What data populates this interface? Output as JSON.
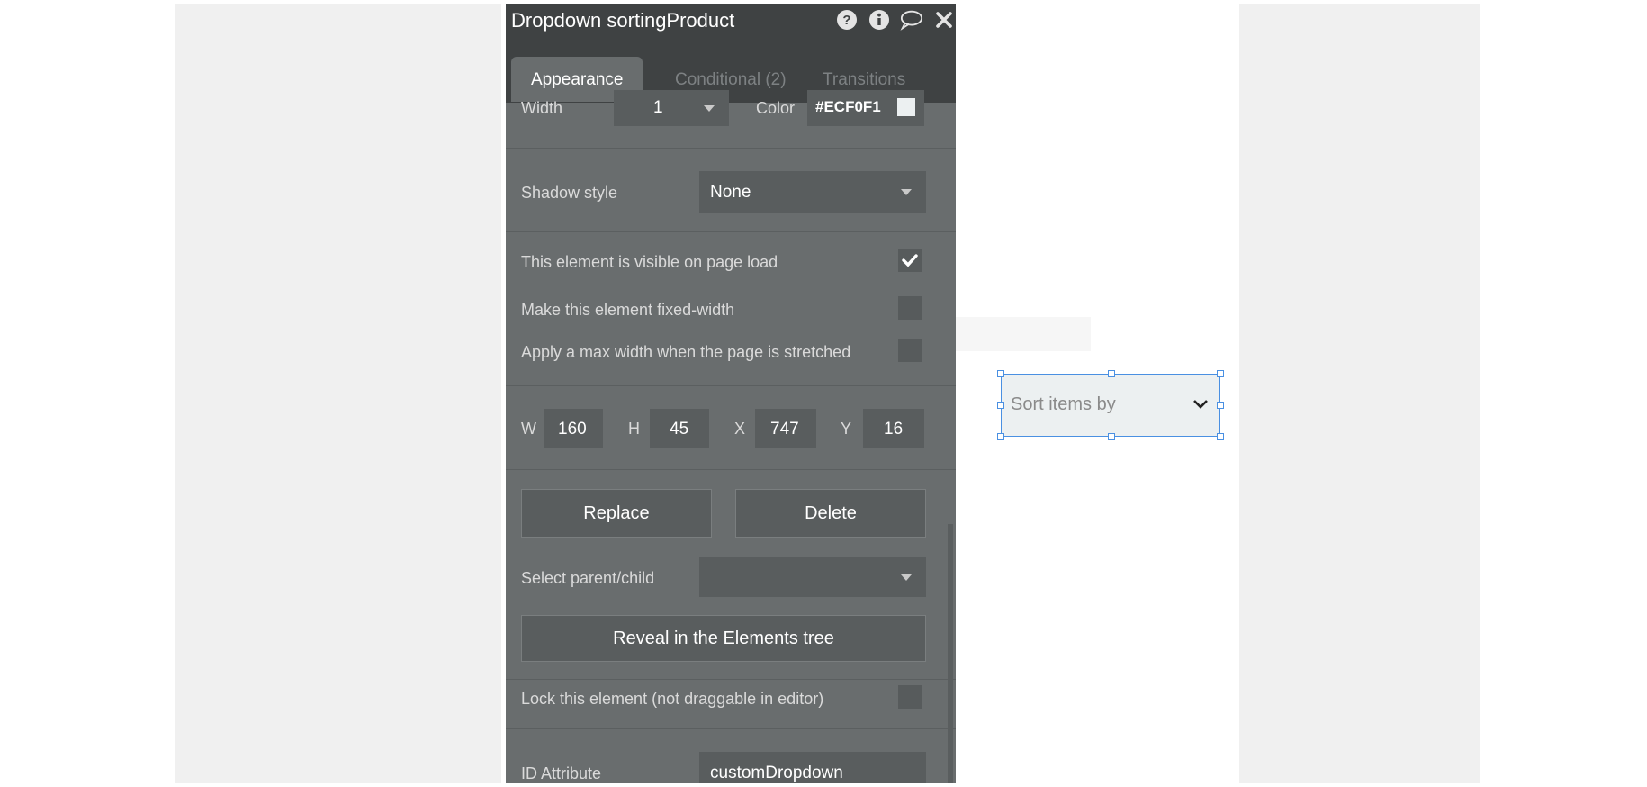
{
  "panel": {
    "title": "Dropdown sortingProduct",
    "tabs": [
      {
        "label": "Appearance"
      },
      {
        "label": "Conditional (2)"
      },
      {
        "label": "Transitions"
      }
    ],
    "border": {
      "width_label": "Width",
      "width_value": "1",
      "color_label": "Color",
      "color_value": "#ECF0F1"
    },
    "shadow": {
      "label": "Shadow style",
      "value": "None"
    },
    "checks": [
      {
        "label": "This element is visible on page load",
        "checked": true
      },
      {
        "label": "Make this element fixed-width",
        "checked": false
      },
      {
        "label": "Apply a max width when the page is stretched",
        "checked": false
      }
    ],
    "dims": {
      "w_label": "W",
      "w": "160",
      "h_label": "H",
      "h": "45",
      "x_label": "X",
      "x": "747",
      "y_label": "Y",
      "y": "16"
    },
    "replace_label": "Replace",
    "delete_label": "Delete",
    "parent_child_label": "Select parent/child",
    "reveal_label": "Reveal in the Elements tree",
    "lock_label": "Lock this element (not draggable in editor)",
    "id_attr_label": "ID Attribute",
    "id_attr_value": "customDropdown"
  },
  "canvas": {
    "dropdown_placeholder": "Sort items by"
  },
  "icons": [
    "help-icon",
    "info-icon",
    "comment-icon",
    "close-icon",
    "check-icon",
    "chevron-down-icon"
  ],
  "colors": {
    "swatch": "#ECF0F1",
    "selection": "#4a90e2"
  }
}
